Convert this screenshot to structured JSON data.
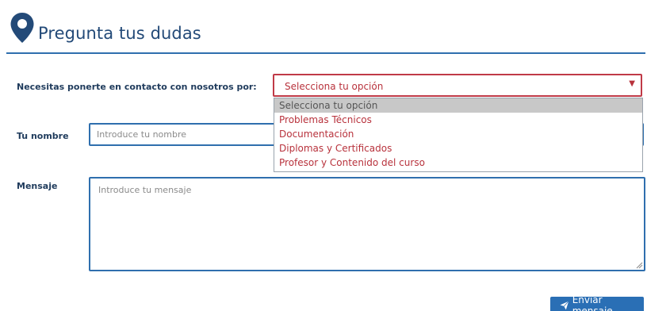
{
  "header": {
    "title": "Pregunta tus dudas",
    "icon": "map-pin-icon",
    "accent": "#2f6fae"
  },
  "contact": {
    "label": "Necesitas ponerte en contacto con nosotros por:",
    "selected": "Selecciona tu opción",
    "options": [
      "Selecciona tu opción",
      "Problemas Técnicos",
      "Documentación",
      "Diplomas y Certificados",
      "Profesor y Contenido del curso"
    ]
  },
  "name": {
    "label": "Tu nombre",
    "placeholder": "Introduce tu nombre",
    "value": ""
  },
  "message": {
    "label": "Mensaje",
    "placeholder": "Introduce tu mensaje",
    "value": ""
  },
  "send": {
    "label": "Enviar mensaje",
    "icon": "paper-plane-icon"
  },
  "colors": {
    "select_accent": "#c03a47",
    "button_bg": "#2a6fb5",
    "highlight_option": "#c8c8c8"
  }
}
